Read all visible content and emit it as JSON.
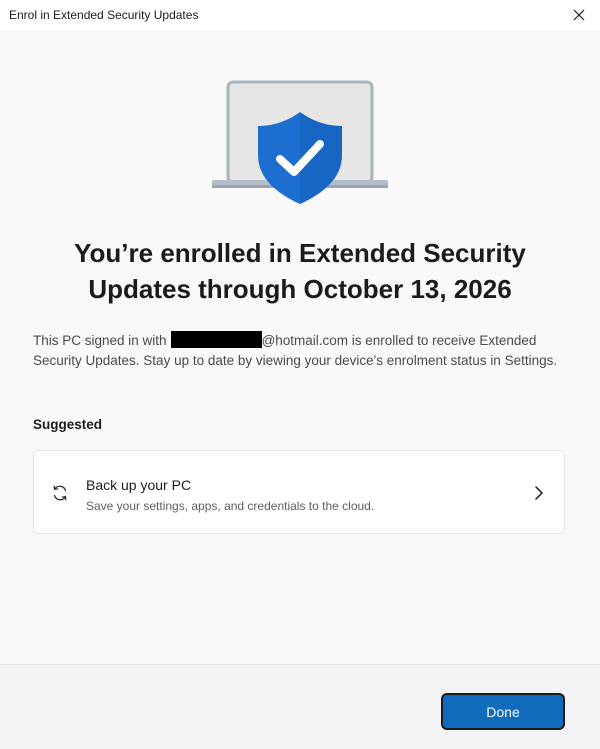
{
  "window": {
    "title": "Enrol in Extended Security Updates",
    "close_icon": "close-icon"
  },
  "hero": {
    "icon": "laptop-shield-check-icon",
    "accent_color": "#0f6cbd"
  },
  "headline": "You’re enrolled in Extended Security Updates through October 13, 2026",
  "body": {
    "text_before": "This PC signed in with",
    "text_after": "@hotmail.com is enrolled to receive Extended Security Updates. Stay up to date by viewing your device's enrolment status in Settings."
  },
  "suggested": {
    "label": "Suggested",
    "card": {
      "icon": "sync-icon",
      "title": "Back up your PC",
      "subtitle": "Save your settings, apps, and credentials to the cloud.",
      "chevron_icon": "chevron-right-icon"
    }
  },
  "footer": {
    "done_label": "Done"
  }
}
